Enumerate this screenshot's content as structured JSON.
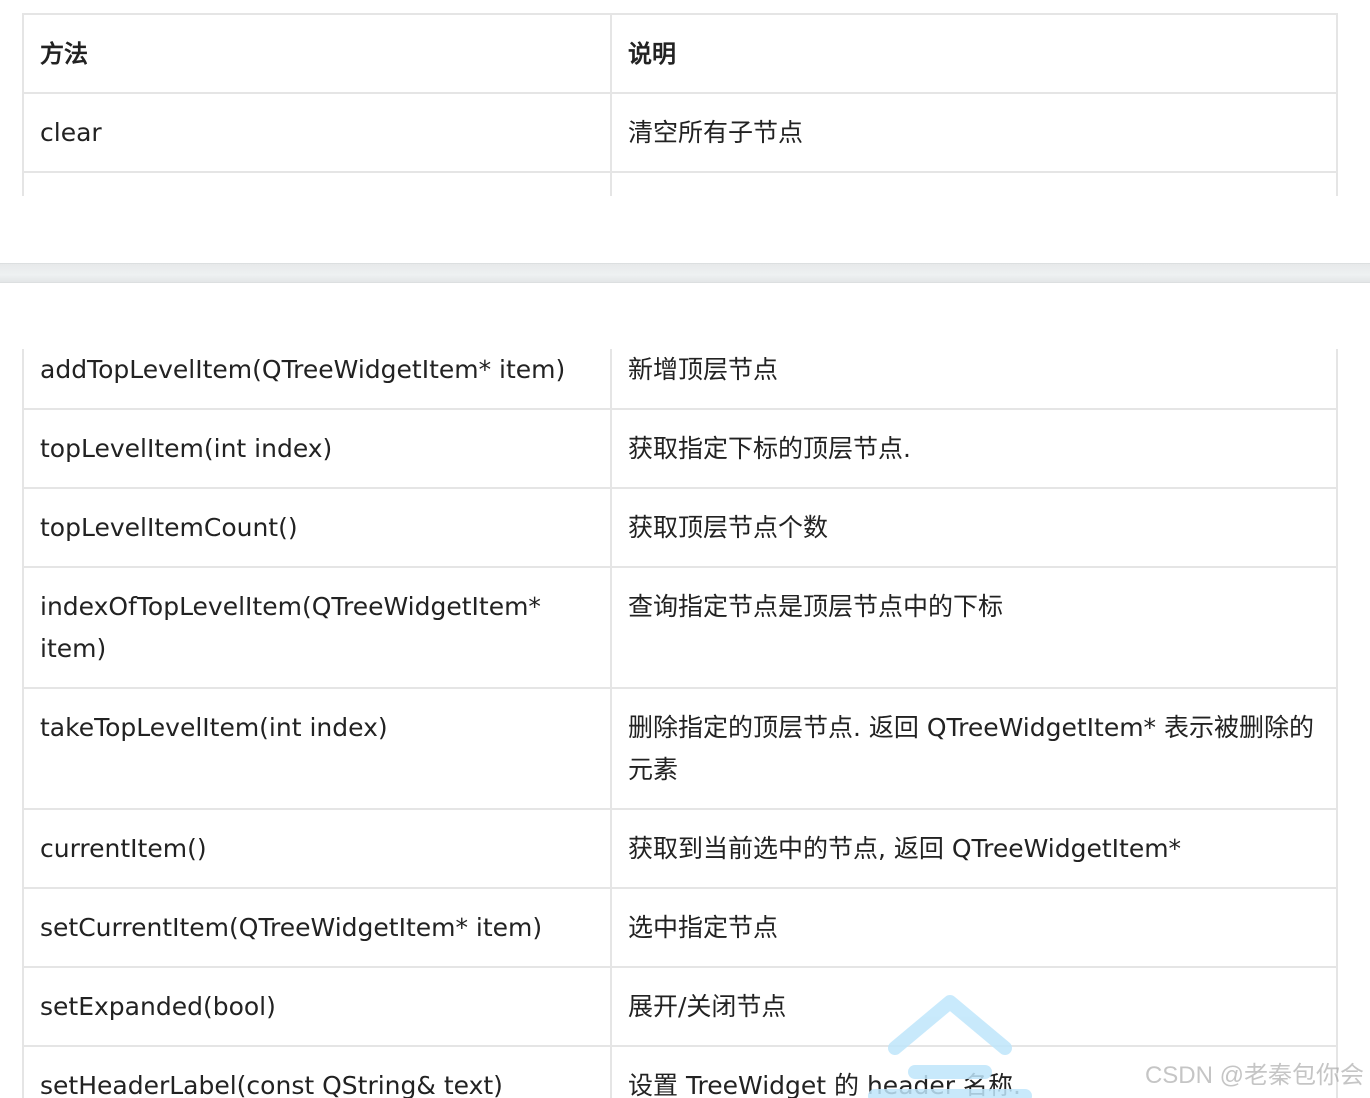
{
  "top_table": {
    "headers": [
      "方法",
      "说明"
    ],
    "rows": [
      [
        "clear",
        "清空所有子节点"
      ]
    ]
  },
  "bottom_table": {
    "rows": [
      [
        "addTopLevelItem(QTreeWidgetItem* item)",
        "新增顶层节点"
      ],
      [
        "topLevelItem(int index)",
        "获取指定下标的顶层节点."
      ],
      [
        "topLevelItemCount()",
        "获取顶层节点个数"
      ],
      [
        "indexOfTopLevelItem(QTreeWidgetItem* item)",
        "查询指定节点是顶层节点中的下标"
      ],
      [
        "takeTopLevelItem(int index)",
        "删除指定的顶层节点. 返回 QTreeWidgetItem* 表示被删除的元素"
      ],
      [
        "currentItem()",
        "获取到当前选中的节点, 返回 QTreeWidgetItem*"
      ],
      [
        "setCurrentItem(QTreeWidgetItem* item)",
        "选中指定节点"
      ],
      [
        "setExpanded(bool)",
        "展开/关闭节点"
      ],
      [
        "setHeaderLabel(const QString& text)",
        "设置 TreeWidget 的 header 名称."
      ]
    ]
  },
  "watermark": {
    "text": "CSDN @老秦包你会"
  },
  "colors": {
    "border": "#e5e5e5",
    "separator": "#e9eced",
    "watermark_logo": "#bfe6fb"
  }
}
